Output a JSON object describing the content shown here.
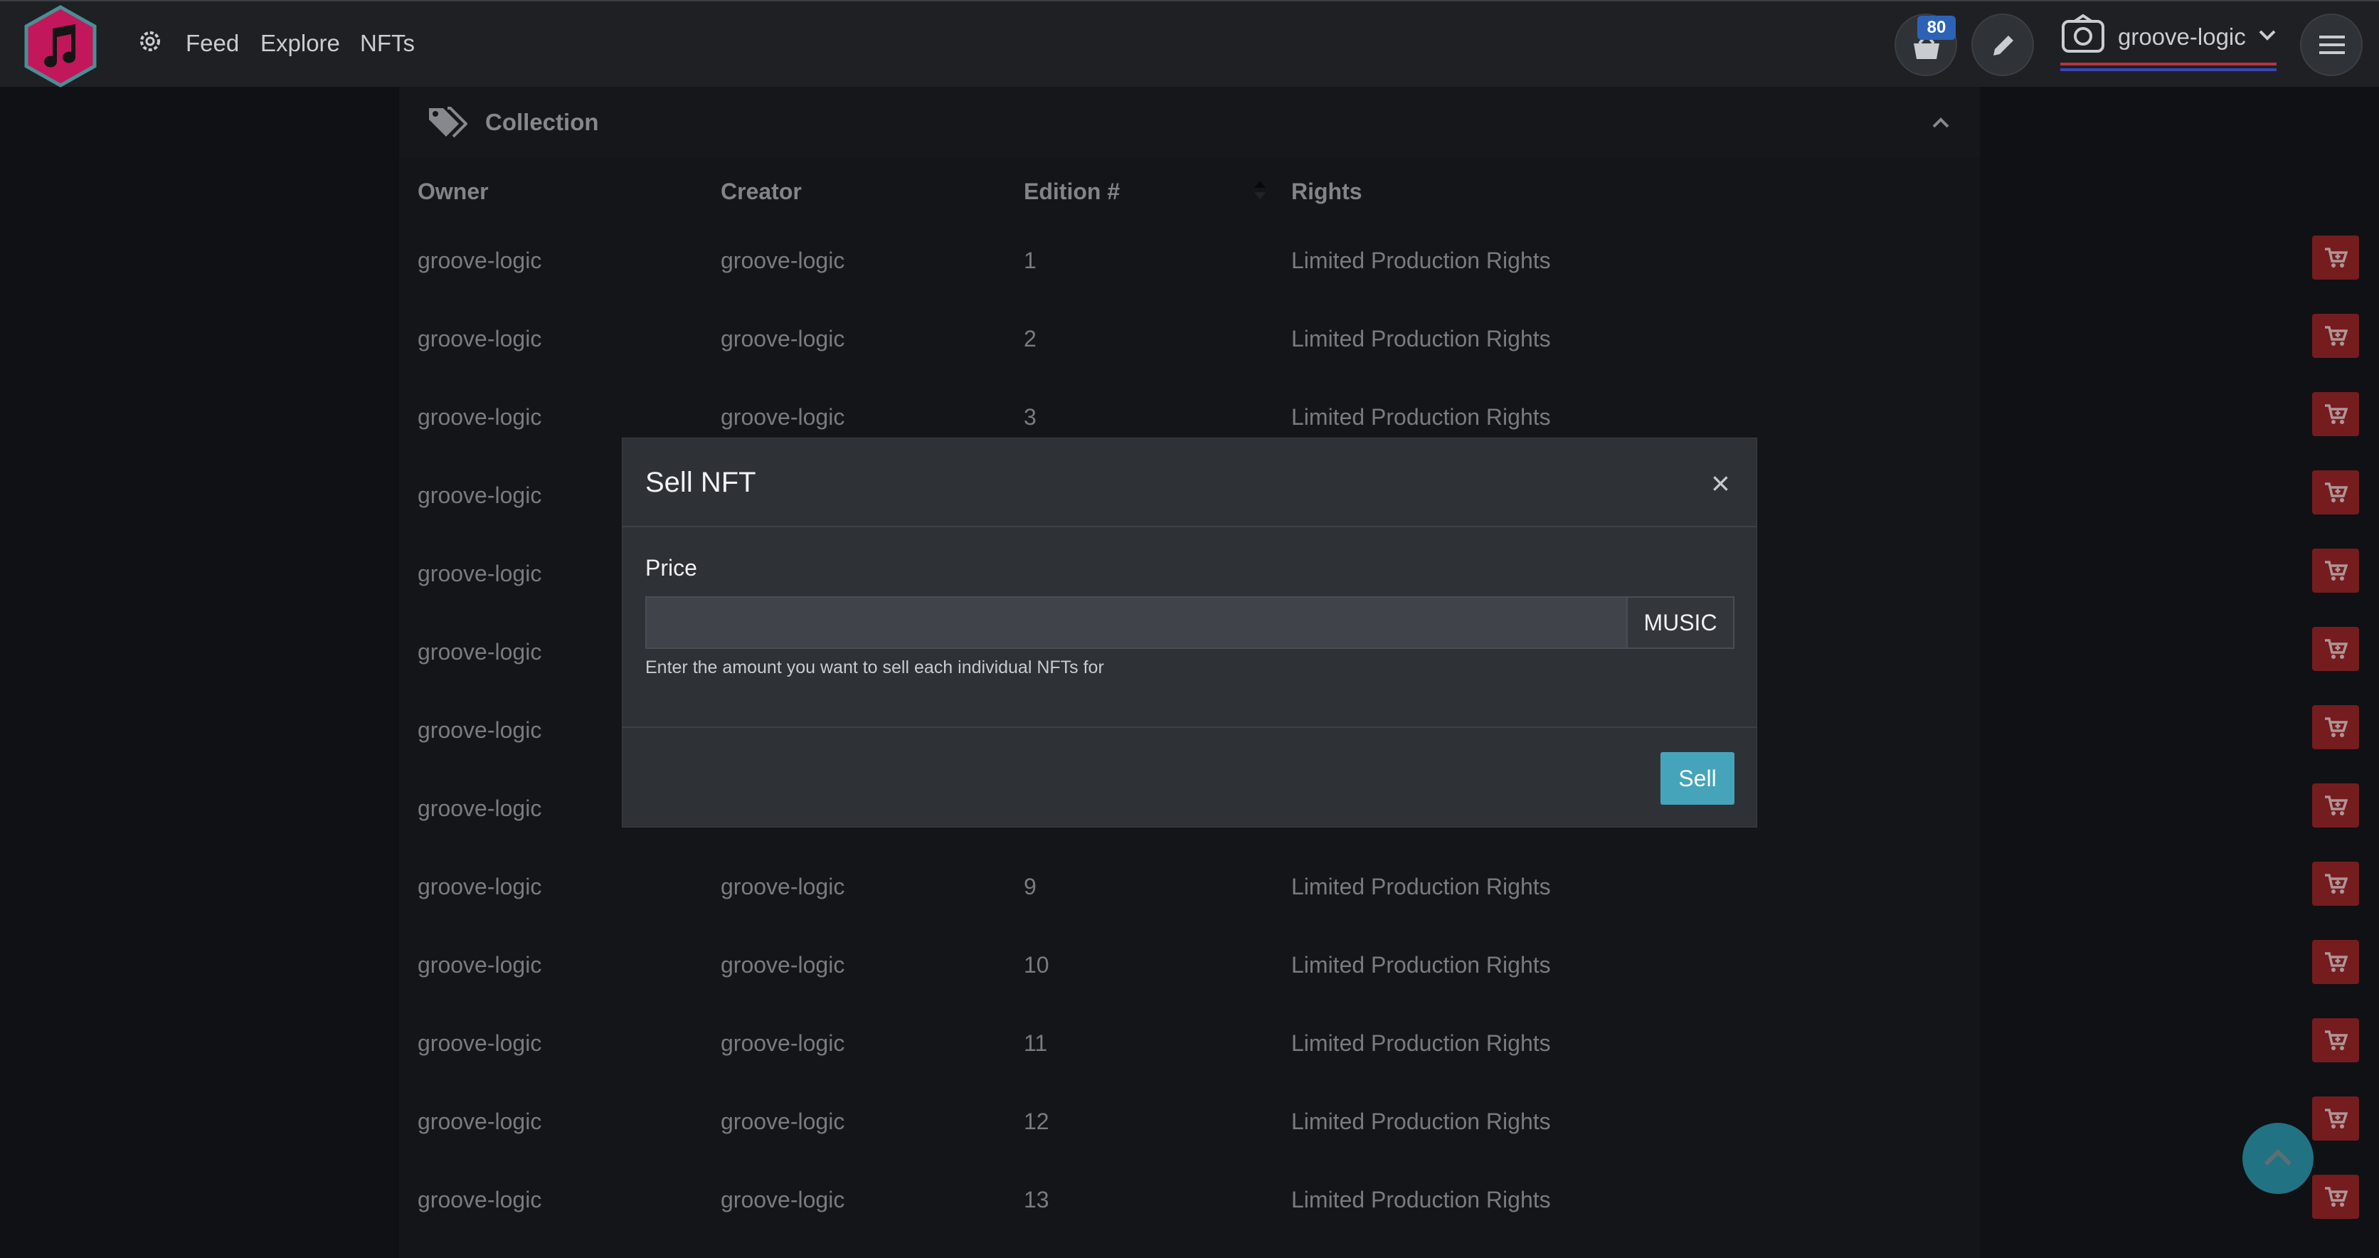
{
  "nav": {
    "feed": "Feed",
    "explore": "Explore",
    "nfts": "NFTs",
    "cart_count": "80",
    "username": "groove-logic"
  },
  "collection": {
    "title": "Collection",
    "columns": [
      "Owner",
      "Creator",
      "Edition #",
      "Rights"
    ],
    "rows": [
      {
        "owner": "groove-logic",
        "creator": "groove-logic",
        "edition": "1",
        "rights": "Limited Production Rights"
      },
      {
        "owner": "groove-logic",
        "creator": "groove-logic",
        "edition": "2",
        "rights": "Limited Production Rights"
      },
      {
        "owner": "groove-logic",
        "creator": "groove-logic",
        "edition": "3",
        "rights": "Limited Production Rights"
      },
      {
        "owner": "groove-logic",
        "creator": "",
        "edition": "",
        "rights": ""
      },
      {
        "owner": "groove-logic",
        "creator": "",
        "edition": "",
        "rights": ""
      },
      {
        "owner": "groove-logic",
        "creator": "",
        "edition": "",
        "rights": ""
      },
      {
        "owner": "groove-logic",
        "creator": "",
        "edition": "",
        "rights": ""
      },
      {
        "owner": "groove-logic",
        "creator": "",
        "edition": "",
        "rights": ""
      },
      {
        "owner": "groove-logic",
        "creator": "groove-logic",
        "edition": "9",
        "rights": "Limited Production Rights"
      },
      {
        "owner": "groove-logic",
        "creator": "groove-logic",
        "edition": "10",
        "rights": "Limited Production Rights"
      },
      {
        "owner": "groove-logic",
        "creator": "groove-logic",
        "edition": "11",
        "rights": "Limited Production Rights"
      },
      {
        "owner": "groove-logic",
        "creator": "groove-logic",
        "edition": "12",
        "rights": "Limited Production Rights"
      },
      {
        "owner": "groove-logic",
        "creator": "groove-logic",
        "edition": "13",
        "rights": "Limited Production Rights"
      }
    ]
  },
  "modal": {
    "title": "Sell NFT",
    "close": "×",
    "price_label": "Price",
    "price_value": "",
    "currency": "MUSIC",
    "help": "Enter the amount you want to sell each individual NFTs for",
    "sell": "Sell"
  },
  "colors": {
    "cart_button": "#a3282c",
    "sell_button": "#45a4ba",
    "badge": "#2d63b6",
    "logo": "#c2185b"
  }
}
